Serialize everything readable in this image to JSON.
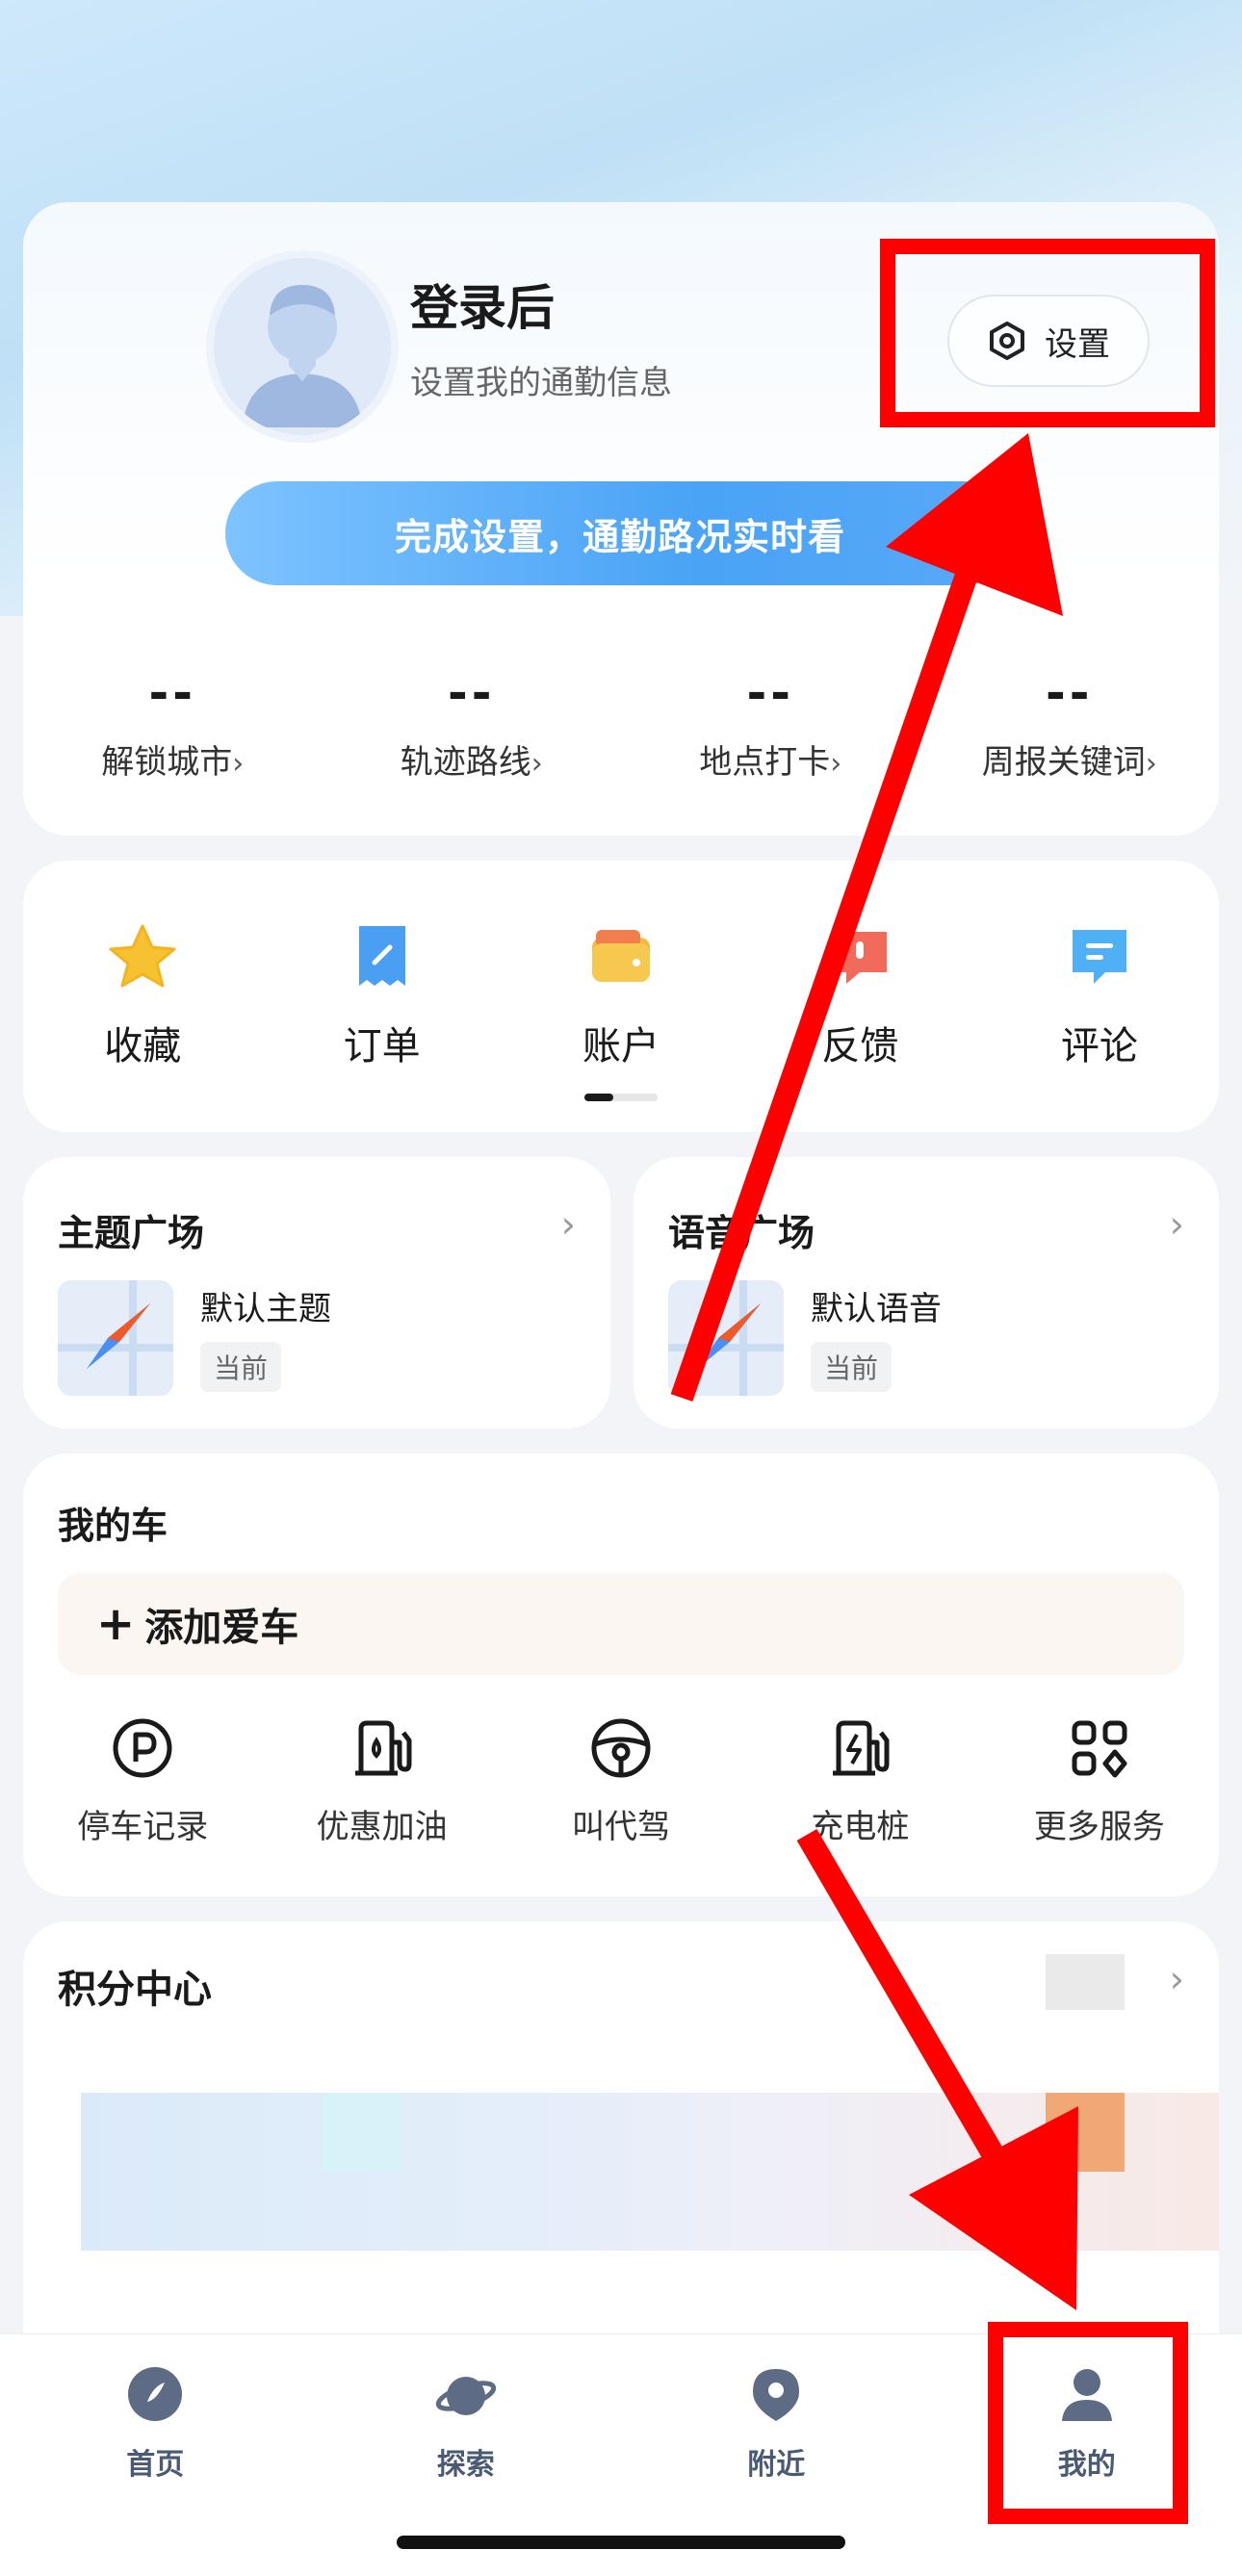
{
  "profile": {
    "title": "登录后",
    "subtitle": "设置我的通勤信息",
    "settings_label": "设置",
    "cta_label": "完成设置，通勤路况实时看",
    "stats": [
      {
        "value": "--",
        "label": "解锁城市",
        "chevron": "›"
      },
      {
        "value": "--",
        "label": "轨迹路线",
        "chevron": "›"
      },
      {
        "value": "--",
        "label": "地点打卡",
        "chevron": "›"
      },
      {
        "value": "--",
        "label": "周报关键词",
        "chevron": "›"
      }
    ]
  },
  "shortcuts": [
    {
      "label": "收藏",
      "icon": "star-icon",
      "color": "#f7c232"
    },
    {
      "label": "订单",
      "icon": "order-icon",
      "color": "#4b9ff2"
    },
    {
      "label": "账户",
      "icon": "wallet-icon",
      "color": "#f5b93e"
    },
    {
      "label": "反馈",
      "icon": "feedback-icon",
      "color": "#f26a5a"
    },
    {
      "label": "评论",
      "icon": "comment-icon",
      "color": "#4fb0f5"
    }
  ],
  "theme": {
    "title": "主题广场",
    "item": "默认主题",
    "badge": "当前"
  },
  "voice": {
    "title": "语音广场",
    "item": "默认语音",
    "badge": "当前"
  },
  "car": {
    "title": "我的车",
    "add_label": "添加爱车",
    "services": [
      {
        "label": "停车记录",
        "icon": "parking-icon"
      },
      {
        "label": "优惠加油",
        "icon": "fuel-icon"
      },
      {
        "label": "叫代驾",
        "icon": "steering-wheel-icon"
      },
      {
        "label": "充电桩",
        "icon": "charging-icon"
      },
      {
        "label": "更多服务",
        "icon": "grid-icon"
      }
    ]
  },
  "points": {
    "title": "积分中心"
  },
  "nav": [
    {
      "label": "首页",
      "icon": "compass-icon"
    },
    {
      "label": "探索",
      "icon": "planet-icon"
    },
    {
      "label": "附近",
      "icon": "location-icon"
    },
    {
      "label": "我的",
      "icon": "profile-icon"
    }
  ],
  "colors": {
    "accent": "#4aa3f5",
    "annotation": "#ff0000",
    "nav_icon": "#5d6b85"
  }
}
